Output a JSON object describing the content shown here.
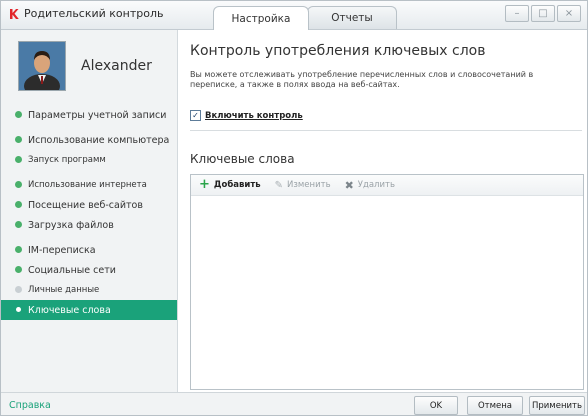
{
  "window": {
    "title": "Родительский контроль",
    "tabs": [
      {
        "label": "Настройка",
        "active": true
      },
      {
        "label": "Отчеты",
        "active": false
      }
    ],
    "controls": {
      "minimize": "–",
      "maximize": "□",
      "close": "×"
    }
  },
  "sidebar": {
    "user_name": "Alexander",
    "items": [
      {
        "label": "Параметры учетной записи",
        "state": "green"
      },
      {
        "label": "Использование компьютера",
        "state": "green"
      },
      {
        "label": "Запуск программ",
        "state": "green"
      },
      {
        "label": "Использование интернета",
        "state": "green"
      },
      {
        "label": "Посещение веб-сайтов",
        "state": "green"
      },
      {
        "label": "Загрузка файлов",
        "state": "green"
      },
      {
        "label": "IM-переписка",
        "state": "green"
      },
      {
        "label": "Социальные сети",
        "state": "green"
      },
      {
        "label": "Личные данные",
        "state": "grey"
      },
      {
        "label": "Ключевые слова",
        "state": "active"
      }
    ]
  },
  "main": {
    "title": "Контроль употребления ключевых слов",
    "description": "Вы можете отслеживать употребление перечисленных слов и словосочетаний в переписке, а также в полях ввода на веб-сайтах.",
    "enable_checkbox": {
      "label": "Включить контроль",
      "checked": true
    },
    "keywords_title": "Ключевые слова",
    "toolbar": {
      "add": "Добавить",
      "edit": "Изменить",
      "delete": "Удалить"
    }
  },
  "footer": {
    "help": "Справка",
    "ok": "OK",
    "cancel": "Отмена",
    "apply": "Применить"
  },
  "colors": {
    "accent": "#1aa27a",
    "status_green": "#4ab06b",
    "logo_red": "#e2262b"
  }
}
